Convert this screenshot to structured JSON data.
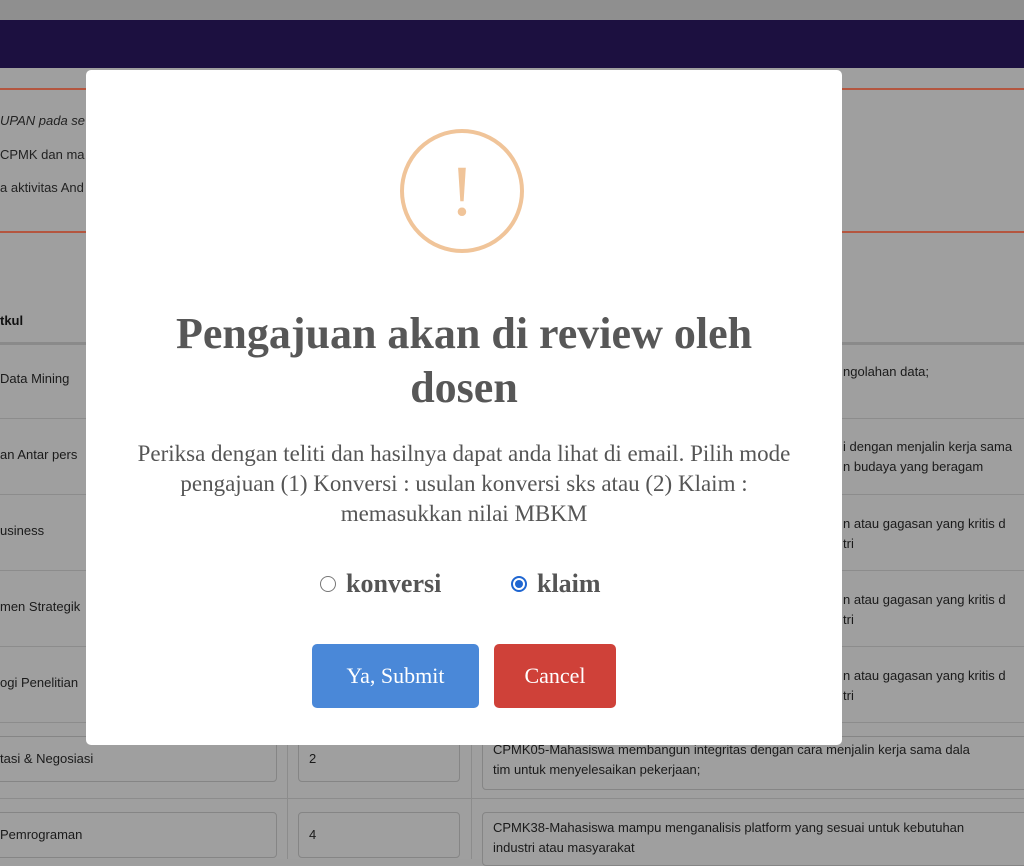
{
  "background": {
    "notes": [
      "UPAN pada se",
      "CPMK dan ma",
      "a aktivitas And"
    ],
    "table_header": "tkul",
    "rows": [
      {
        "course": "Data Mining",
        "sks": "",
        "desc": [
          "ngolahan data;"
        ]
      },
      {
        "course": "an Antar pers",
        "sks": "",
        "desc": [
          "i dengan menjalin kerja sama",
          "n budaya yang beragam"
        ]
      },
      {
        "course": "usiness",
        "sks": "",
        "desc": [
          "n atau gagasan yang kritis d",
          "tri"
        ]
      },
      {
        "course": "men Strategik",
        "sks": "",
        "desc": [
          "n atau gagasan yang kritis d",
          "tri"
        ]
      },
      {
        "course": "ogi Penelitian",
        "sks": "",
        "desc": [
          "n atau gagasan yang kritis d",
          "tri"
        ]
      },
      {
        "course": "tasi & Negosiasi",
        "sks": "2",
        "desc": [
          "CPMK05-Mahasiswa membangun integritas dengan cara menjalin kerja sama dala",
          "tim untuk menyelesaikan pekerjaan;"
        ]
      },
      {
        "course": "Pemrograman",
        "sks": "4",
        "desc": [
          "CPMK38-Mahasiswa mampu menganalisis platform yang sesuai untuk kebutuhan",
          "industri atau masyarakat"
        ]
      }
    ]
  },
  "modal": {
    "icon": "exclamation-icon",
    "icon_glyph": "!",
    "title": "Pengajuan akan di review oleh dosen",
    "text": "Periksa dengan teliti dan hasilnya dapat anda lihat di email. Pilih mode pengajuan (1) Konversi : usulan konversi sks atau (2) Klaim : memasukkan nilai MBKM",
    "options": [
      {
        "label": "konversi",
        "selected": false
      },
      {
        "label": "klaim",
        "selected": true
      }
    ],
    "confirm_label": "Ya, Submit",
    "cancel_label": "Cancel"
  },
  "colors": {
    "navbar": "#1c1040",
    "warning": "#f0c499",
    "confirm": "#4a88d8",
    "cancel": "#cf4139"
  }
}
